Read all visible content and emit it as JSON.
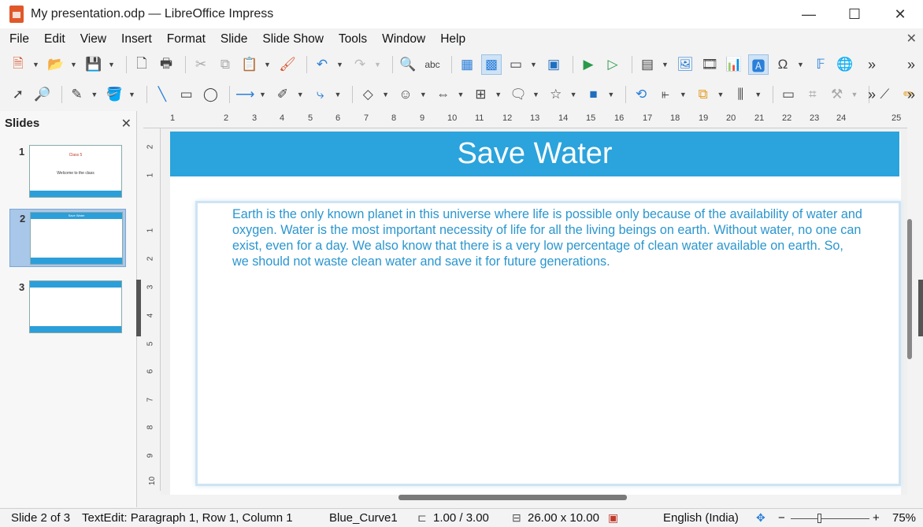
{
  "window": {
    "title": "My presentation.odp — LibreOffice Impress",
    "minimize": "—",
    "maximize": "☐",
    "close": "✕"
  },
  "menu": {
    "items": [
      "File",
      "Edit",
      "View",
      "Insert",
      "Format",
      "Slide",
      "Slide Show",
      "Tools",
      "Window",
      "Help"
    ],
    "close": "✕"
  },
  "toolbar": {
    "more": "»"
  },
  "slides_pane": {
    "title": "Slides",
    "close": "✕",
    "slides": [
      {
        "number": "1",
        "title": "Class 5",
        "subtitle": "Welcome to the class"
      },
      {
        "number": "2",
        "title": "Save Water"
      },
      {
        "number": "3",
        "title": ""
      }
    ]
  },
  "ruler": {
    "h_ticks": [
      "1",
      "2",
      "3",
      "4",
      "5",
      "6",
      "7",
      "8",
      "9",
      "10",
      "11",
      "12",
      "13",
      "14",
      "15",
      "16",
      "17",
      "18",
      "19",
      "20",
      "21",
      "22",
      "23",
      "24",
      "25"
    ],
    "v_ticks": [
      "2",
      "1",
      "1",
      "2",
      "3",
      "4",
      "5",
      "6",
      "7",
      "8",
      "9",
      "10"
    ]
  },
  "slide": {
    "title": "Save Water",
    "body": "Earth is the only known planet in this universe where life is possible only because of the availability of water and oxygen. Water is the most important necessity of life for all the living beings on earth. Without water, no one can exist, even for a day. We also know that there is a very low percentage of clean water available on earth. So, we should not waste clean water and save it for future generations."
  },
  "status": {
    "slide": "Slide 2 of 3",
    "edit": "TextEdit: Paragraph 1, Row 1, Column 1",
    "master": "Blue_Curve1",
    "position": "1.00 / 3.00",
    "size": "26.00 x 10.00",
    "language": "English (India)",
    "zoom_minus": "−",
    "zoom_plus": "+",
    "zoom": "75%"
  },
  "colors": {
    "accent": "#2ba3dc",
    "body_text": "#2a96cf"
  }
}
